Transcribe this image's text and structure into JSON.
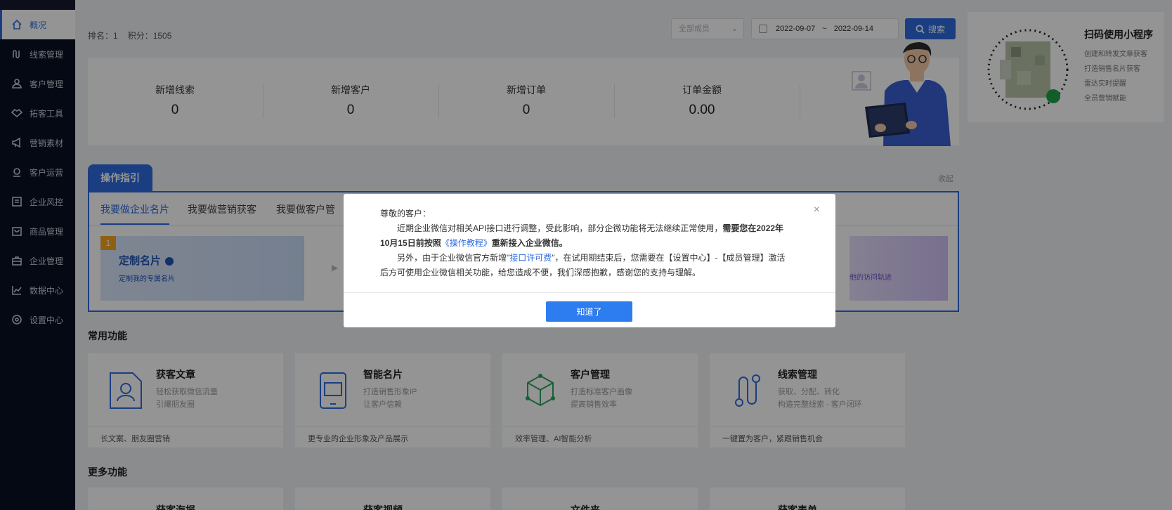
{
  "sidebar": {
    "items": [
      {
        "label": "概况",
        "icon": "home-icon",
        "active": true
      },
      {
        "label": "线索管理",
        "icon": "route-icon"
      },
      {
        "label": "客户管理",
        "icon": "users-icon"
      },
      {
        "label": "拓客工具",
        "icon": "handshake-icon"
      },
      {
        "label": "营销素材",
        "icon": "megaphone-icon"
      },
      {
        "label": "客户运营",
        "icon": "gear-hand-icon"
      },
      {
        "label": "企业风控",
        "icon": "doc-icon"
      },
      {
        "label": "商品管理",
        "icon": "bag-icon"
      },
      {
        "label": "企业管理",
        "icon": "briefcase-icon"
      },
      {
        "label": "数据中心",
        "icon": "chart-icon"
      },
      {
        "label": "设置中心",
        "icon": "settings-icon"
      }
    ]
  },
  "header": {
    "rank": "排名：1",
    "score": "积分：1505",
    "dept_placeholder": "全部成员",
    "date_start": "2022-09-07",
    "date_sep": "~",
    "date_end": "2022-09-14",
    "search_label": "搜索"
  },
  "stats": [
    {
      "label": "新增线索",
      "value": "0"
    },
    {
      "label": "新增客户",
      "value": "0"
    },
    {
      "label": "新增订单",
      "value": "0"
    },
    {
      "label": "订单金额",
      "value": "0.00"
    }
  ],
  "qr": {
    "title": "扫码使用小程序",
    "lines": [
      "创建和转发文章获客",
      "打造销售名片获客",
      "雷达实时提醒",
      "全员营销赋能"
    ]
  },
  "guide": {
    "tab_label": "操作指引",
    "collapse_label": "收起",
    "tabs": [
      "我要做企业名片",
      "我要做营销获客",
      "我要做客户管"
    ],
    "step_num": "1",
    "step_title": "定制名片",
    "step_sub": "定制我的专属名片",
    "right_sub": "他的访问轨迹"
  },
  "common": {
    "title": "常用功能",
    "items": [
      {
        "title": "获客文章",
        "sub1": "轻松获取微信流量",
        "sub2": "引爆朋友圈",
        "bottom": "长文案、朋友圈营销"
      },
      {
        "title": "智能名片",
        "sub1": "打造销售形象IP",
        "sub2": "让客户信赖",
        "bottom": "更专业的企业形象及产品展示"
      },
      {
        "title": "客户管理",
        "sub1": "打造标准客户画像",
        "sub2": "提高销售效率",
        "bottom": "效率管理、AI智能分析"
      },
      {
        "title": "线索管理",
        "sub1": "获取、分配、转化",
        "sub2": "构造完整线索 - 客户闭环",
        "bottom": "一键置为客户，紧跟销售机会"
      }
    ]
  },
  "more": {
    "title": "更多功能",
    "items": [
      "获客海报",
      "获客视频",
      "文件夹",
      "获客表单"
    ]
  },
  "modal": {
    "greeting": "尊敬的客户：",
    "p1_a": "近期企业微信对相关API接口进行调整，受此影响，部分企微功能将无法继续正常使用，",
    "p1_b": "需要您在2022年",
    "p1_c": "10月15日前按照",
    "p1_link": "《操作教程》",
    "p1_d": "重新接入企业微信。",
    "p2_a": "另外，由于企业微信官方新增\"",
    "p2_link": "接口许可费",
    "p2_b": "\"，在试用期结束后，您需要在【设置中心】-【成员管理】激活",
    "p2_c": "后方可使用企业微信相关功能，给您造成不便，我们深感抱歉，感谢您的支持与理解。",
    "close": "×",
    "ok_label": "知道了"
  },
  "colors": {
    "primary": "#2d6cdf",
    "sidebar_bg": "#0a1024"
  }
}
